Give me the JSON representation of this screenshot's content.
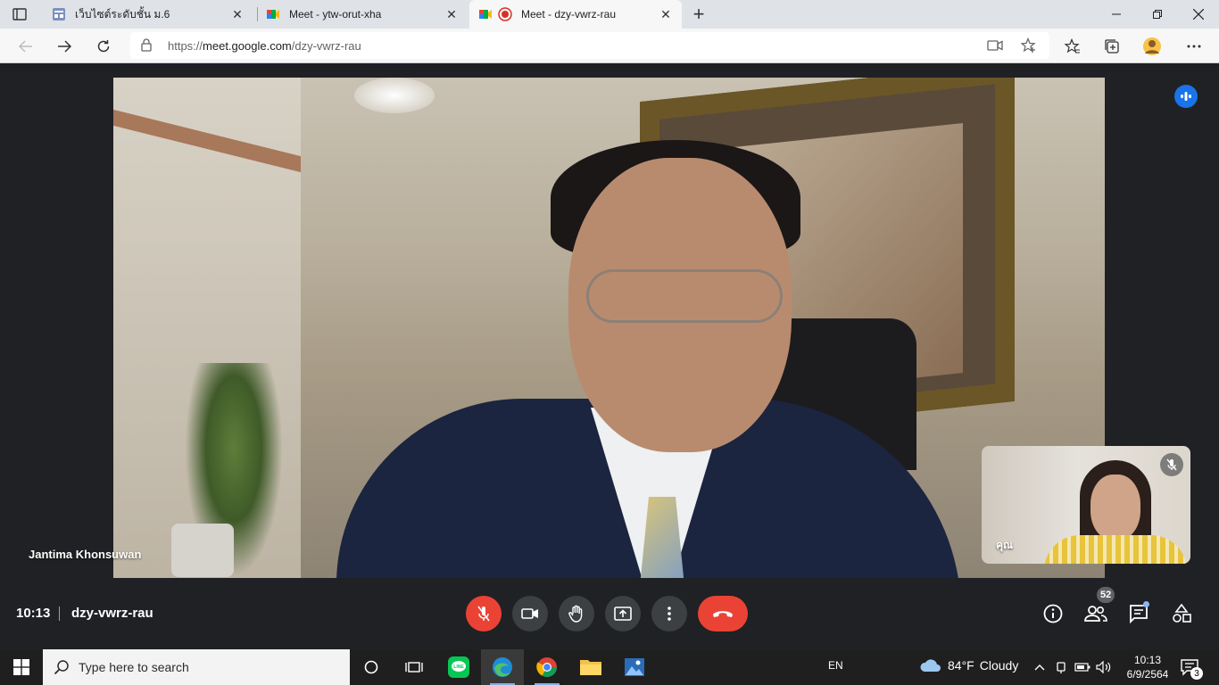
{
  "browser": {
    "tabs": [
      {
        "title": "เว็บไซต์ระดับชั้น ม.6",
        "favicon": "sites-icon",
        "active": false
      },
      {
        "title": "Meet - ytw-orut-xha",
        "favicon": "meet-icon",
        "active": false
      },
      {
        "title": "Meet - dzy-vwrz-rau",
        "favicon": "meet-icon",
        "active": true,
        "recording": true
      }
    ],
    "url_prefix": "https://",
    "url_host": "meet.google.com",
    "url_path": "/dzy-vwrz-rau"
  },
  "meet": {
    "main_participant_name": "Jantima Khonsuwan",
    "self_name": "คุณ",
    "time": "10:13",
    "meeting_code": "dzy-vwrz-rau",
    "participants_count": "52",
    "accent_blue": "#1a73e8",
    "danger_red": "#ea4335"
  },
  "taskbar": {
    "search_placeholder": "Type here to search",
    "language": "EN",
    "temperature": "84°F",
    "weather": "Cloudy",
    "clock_time": "10:13",
    "clock_date": "6/9/2564",
    "notification_count": "3"
  }
}
